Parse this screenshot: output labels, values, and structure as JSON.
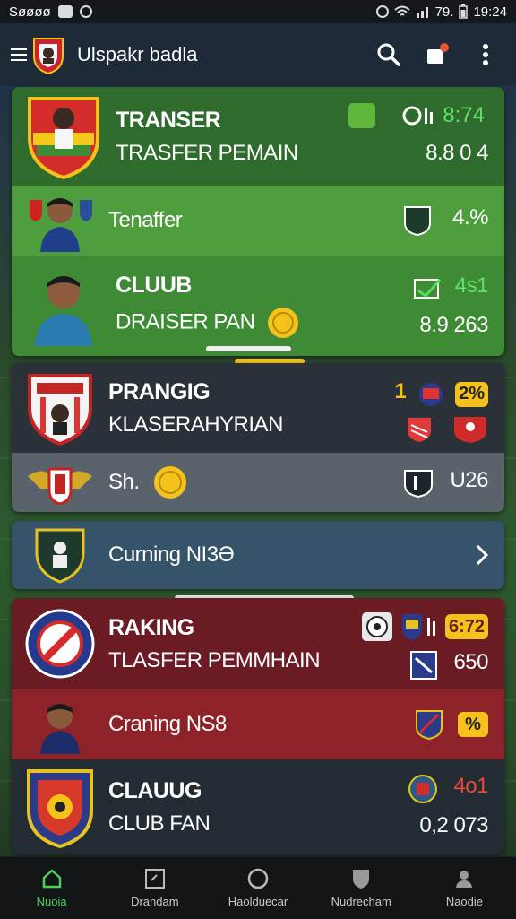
{
  "status_bar": {
    "carrier": "Søøøø",
    "battery": "79.",
    "time": "19:24"
  },
  "app_bar": {
    "title": "Ulspakr badla",
    "icons": [
      "menu-icon",
      "club-logo",
      "search-icon",
      "notification-icon",
      "more-icon"
    ]
  },
  "sections": [
    {
      "rows": [
        {
          "title": "TRANSER",
          "subtitle": "TRASFER PEMAIN",
          "badge_text": "8:74",
          "stat": "8.8   0 4",
          "icons": [
            "shield-icon",
            "trophy-icon",
            "clock-icon"
          ]
        },
        {
          "label": "Tenaffer",
          "stat": "4.%",
          "icons": [
            "player-icon",
            "badge-icon"
          ]
        },
        {
          "title": "CLUUB",
          "subtitle": "DRAISER PAN",
          "badge_text": "4s1",
          "stat": "8.9   263",
          "icons": [
            "player-icon",
            "coin-icon",
            "check-icon"
          ]
        }
      ]
    },
    {
      "rows": [
        {
          "title": "PRANGIG",
          "subtitle": "KLASERAHYRIAN",
          "rank": "1",
          "badge_text": "2%",
          "icons": [
            "crest-icon",
            "flag-icon"
          ]
        },
        {
          "label": "Sh.",
          "stat": "U26",
          "icons": [
            "eagle-crest-icon",
            "coin-icon",
            "shirt-icon"
          ]
        }
      ]
    },
    {
      "rows": [
        {
          "label": "Curning NI3Ə",
          "icons": [
            "club-crest-icon",
            "chevron-right-icon"
          ]
        }
      ]
    },
    {
      "rows": [
        {
          "title": "RAKING",
          "subtitle": "TLASFER PEMMHAIN",
          "badge_text": "6:72",
          "stat": "650",
          "icons": [
            "ball-icon",
            "flag-icon",
            "crest-icon"
          ]
        },
        {
          "label": "Craning NS8",
          "badge_text": "%",
          "icons": [
            "player-icon",
            "shield-icon"
          ]
        },
        {
          "title": "CLAUUG",
          "subtitle": "CLUB FAN",
          "stat": "0,2   073",
          "red_stat": "4o1",
          "icons": [
            "crest-icon",
            "badge-icon"
          ]
        }
      ]
    }
  ],
  "bottom_nav": [
    {
      "label": "Nuoia",
      "icon": "home-icon",
      "active": true
    },
    {
      "label": "Drandam",
      "icon": "tactics-icon",
      "active": false
    },
    {
      "label": "Haolduecar",
      "icon": "circle-icon",
      "active": false
    },
    {
      "label": "Nudrecham",
      "icon": "shield-icon",
      "active": false
    },
    {
      "label": "Naodie",
      "icon": "profile-icon",
      "active": false
    }
  ],
  "colors": {
    "accent_green": "#4fcf5a",
    "badge_yellow": "#f4c21a",
    "card_green": "#2f6b2d",
    "card_red": "#6b1b24",
    "card_dark": "#2a3138"
  }
}
